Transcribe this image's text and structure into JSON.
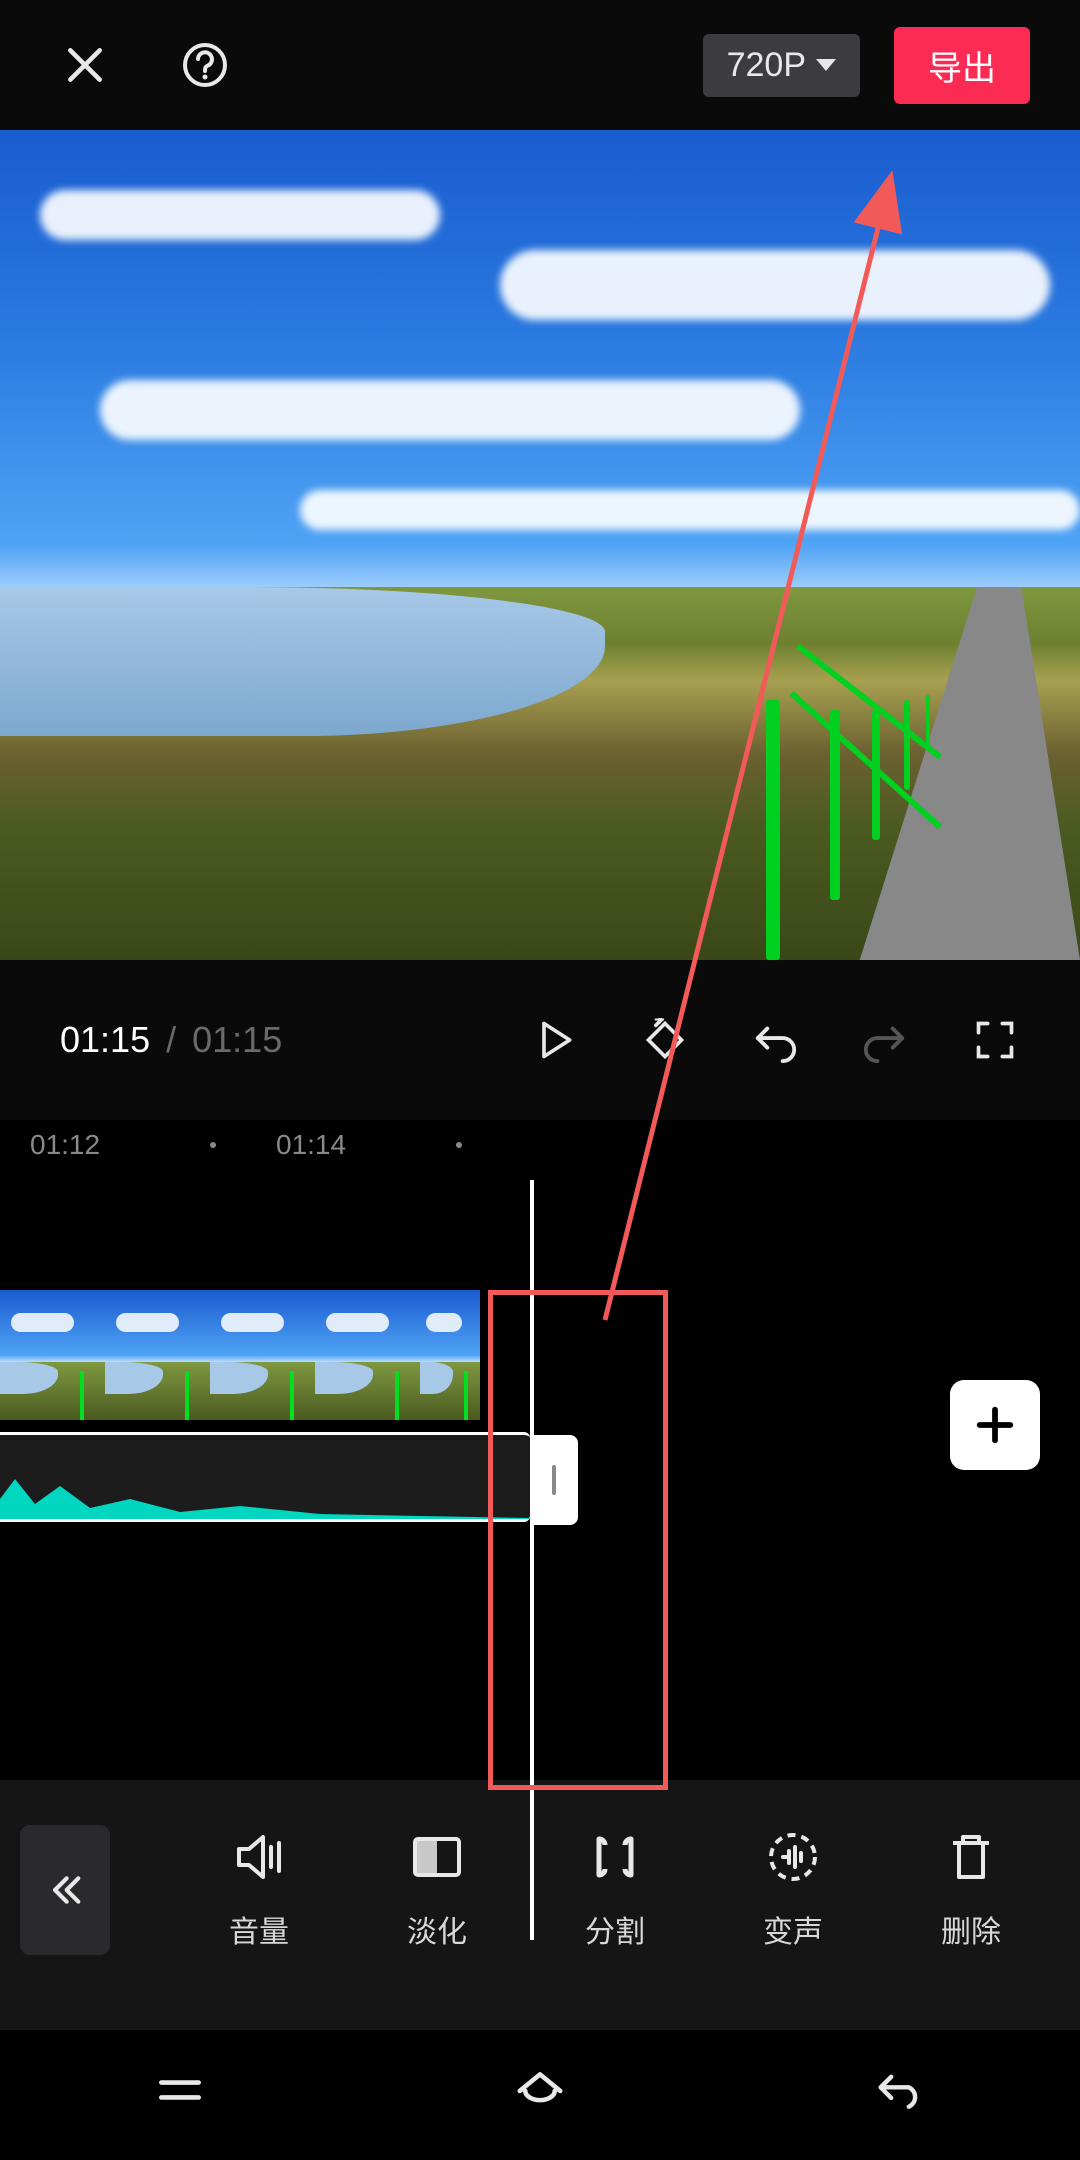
{
  "header": {
    "resolution_label": "720P",
    "export_label": "导出"
  },
  "time": {
    "current": "01:15",
    "separator": "/",
    "duration": "01:15"
  },
  "ruler": {
    "mark1": "01:12",
    "mark2": "01:14"
  },
  "tools": {
    "volume": "音量",
    "fade": "淡化",
    "split": "分割",
    "voice_change": "变声",
    "delete": "删除"
  },
  "icons": {
    "close": "close-icon",
    "help": "help-icon",
    "play": "play-icon",
    "keyframe": "keyframe-icon",
    "undo": "undo-icon",
    "redo": "redo-icon",
    "fullscreen": "fullscreen-icon",
    "add": "plus-icon",
    "back": "chevron-left-double-icon",
    "menu": "menu-icon",
    "home": "home-icon",
    "sys_back": "back-icon"
  },
  "colors": {
    "accent": "#fb2b54",
    "annotation": "#f25a5a",
    "waveform": "#00d6c0"
  }
}
